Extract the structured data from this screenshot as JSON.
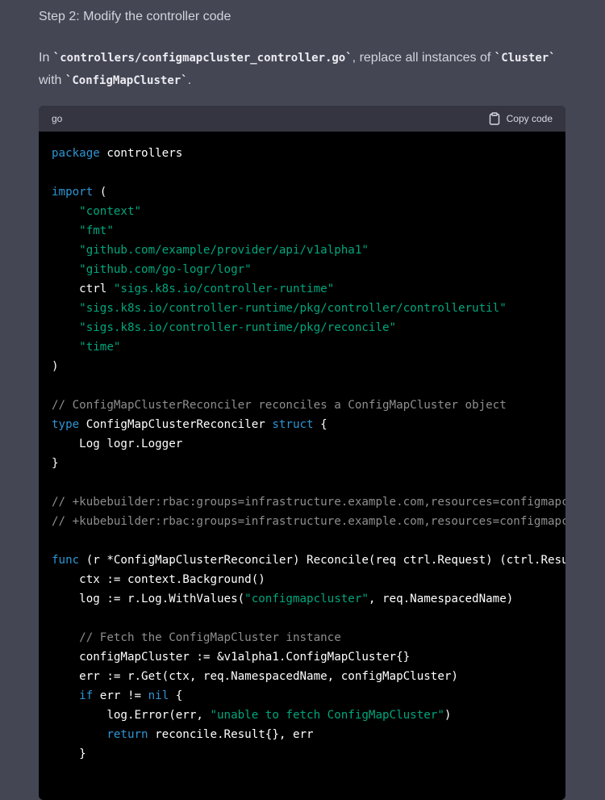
{
  "step_title": "Step 2: Modify the controller code",
  "description": {
    "prefix": "In ",
    "file": "`controllers/configmapcluster_controller.go`",
    "middle": ", replace all instances of ",
    "old": "`Cluster`",
    "with_text": " with ",
    "new": "`ConfigMapCluster`",
    "suffix": "."
  },
  "code_block": {
    "language": "go",
    "copy_label": "Copy code",
    "icon": "clipboard-icon"
  },
  "colors": {
    "page_bg": "#444654",
    "code_bg": "#000000",
    "header_bg": "#343541",
    "keyword": "#2e95d3",
    "string": "#00a67d",
    "comment": "#8e8e8e"
  },
  "code_lines": [
    [
      [
        "kw",
        "package"
      ],
      [
        "pl",
        " controllers"
      ]
    ],
    [],
    [
      [
        "kw",
        "import"
      ],
      [
        "pl",
        " ("
      ]
    ],
    [
      [
        "pl",
        "    "
      ],
      [
        "str",
        "\"context\""
      ]
    ],
    [
      [
        "pl",
        "    "
      ],
      [
        "str",
        "\"fmt\""
      ]
    ],
    [
      [
        "pl",
        "    "
      ],
      [
        "str",
        "\"github.com/example/provider/api/v1alpha1\""
      ]
    ],
    [
      [
        "pl",
        "    "
      ],
      [
        "str",
        "\"github.com/go-logr/logr\""
      ]
    ],
    [
      [
        "pl",
        "    ctrl "
      ],
      [
        "str",
        "\"sigs.k8s.io/controller-runtime\""
      ]
    ],
    [
      [
        "pl",
        "    "
      ],
      [
        "str",
        "\"sigs.k8s.io/controller-runtime/pkg/controller/controllerutil\""
      ]
    ],
    [
      [
        "pl",
        "    "
      ],
      [
        "str",
        "\"sigs.k8s.io/controller-runtime/pkg/reconcile\""
      ]
    ],
    [
      [
        "pl",
        "    "
      ],
      [
        "str",
        "\"time\""
      ]
    ],
    [
      [
        "pl",
        ")"
      ]
    ],
    [],
    [
      [
        "cm",
        "// ConfigMapClusterReconciler reconciles a ConfigMapCluster object"
      ]
    ],
    [
      [
        "kw",
        "type"
      ],
      [
        "pl",
        " ConfigMapClusterReconciler "
      ],
      [
        "kw",
        "struct"
      ],
      [
        "pl",
        " {"
      ]
    ],
    [
      [
        "pl",
        "    Log logr.Logger"
      ]
    ],
    [
      [
        "pl",
        "}"
      ]
    ],
    [],
    [
      [
        "cm",
        "// +kubebuilder:rbac:groups=infrastructure.example.com,resources=configmapcl"
      ]
    ],
    [
      [
        "cm",
        "// +kubebuilder:rbac:groups=infrastructure.example.com,resources=configmapcl"
      ]
    ],
    [],
    [
      [
        "kw",
        "func"
      ],
      [
        "pl",
        " (r *ConfigMapClusterReconciler) Reconcile(req ctrl.Request) (ctrl.Resul"
      ]
    ],
    [
      [
        "pl",
        "    ctx := context.Background()"
      ]
    ],
    [
      [
        "pl",
        "    log := r.Log.WithValues("
      ],
      [
        "str",
        "\"configmapcluster\""
      ],
      [
        "pl",
        ", req.NamespacedName)"
      ]
    ],
    [],
    [
      [
        "pl",
        "    "
      ],
      [
        "cm",
        "// Fetch the ConfigMapCluster instance"
      ]
    ],
    [
      [
        "pl",
        "    configMapCluster := &v1alpha1.ConfigMapCluster{}"
      ]
    ],
    [
      [
        "pl",
        "    err := r.Get(ctx, req.NamespacedName, configMapCluster)"
      ]
    ],
    [
      [
        "pl",
        "    "
      ],
      [
        "kw",
        "if"
      ],
      [
        "pl",
        " err != "
      ],
      [
        "kw",
        "nil"
      ],
      [
        "pl",
        " {"
      ]
    ],
    [
      [
        "pl",
        "        log.Error(err, "
      ],
      [
        "str",
        "\"unable to fetch ConfigMapCluster\""
      ],
      [
        "pl",
        ")"
      ]
    ],
    [
      [
        "pl",
        "        "
      ],
      [
        "kw",
        "return"
      ],
      [
        "pl",
        " reconcile.Result{}, err"
      ]
    ],
    [
      [
        "pl",
        "    }"
      ]
    ]
  ]
}
